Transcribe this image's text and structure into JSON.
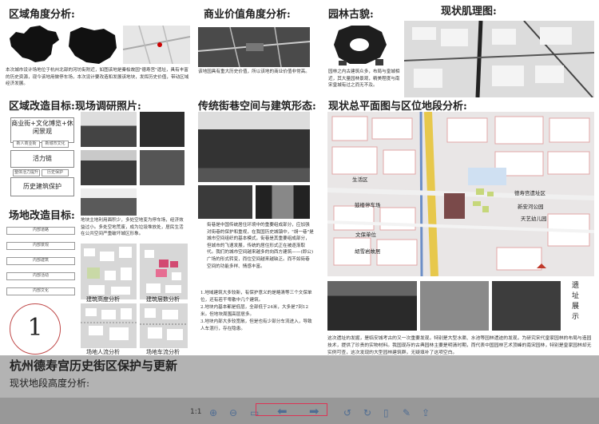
{
  "panels": {
    "region_title": "区域角度分析:",
    "region_text": "本次城市设计场地位于杭州北部的河坊街附近，如图该地是秦桧故园\"德寿宫\"遗址，具有丰富的历史资源，现今该地用做停车场，本次设计要改造和发展该地块，发挥历史价值，带动区域经济发展。",
    "commercial_title": "商业价值角度分析:",
    "commercial_text": "该地园具有重大历史价值，所以该地的商业价值非常高。",
    "garden_title": "园林古貌:",
    "garden_text": "园林之内古建筑众多，布局与皇城相近，其大量园林景观，精美程度与南宋皇城有过之而无不及。",
    "texture_title": "现状肌理图:",
    "transform_title": "区域改造目标:",
    "goal_boxes": [
      "商业街+文化博览+休闲景观",
      "活力链",
      "历史建筑保护"
    ],
    "goal_small_labels": [
      "新人商业街",
      "新城市文化",
      "整体活力提升",
      "历史保护"
    ],
    "survey_title": "现场调研照片:",
    "street_title": "传统街巷空间与建筑形态:",
    "street_text": "街巷是中国传统居住环境中的重要组成部分，应加强对街巷的保护和重视，在我国历史城镇中，\"胡一巷\"是城市空间组织的基本模式，街巷是其重要组成部分，但城市的飞速发展，传统的居住形式正在被逐渐取代。我们的城市空间越来越多的向西方建筑——(即公)广场的形式转变，而住空间越来越缺乏。而不如街巷空间的功能多样、情感丰富。",
    "street_notes": [
      "1.地域建筑大多较新，有保护意义的是略清等三个文保单位，还有若干零散中几个建筑。",
      "2.地块内基本都是低层，全部低于24米，大多是7到12米。但地块周围高层居多。",
      "3.地块内部大多较宽敞，但是也有少部分车流进入，导致人车混行，存在隐患。"
    ],
    "site_goal_title": "场地改造目标:",
    "site_goal_text": "地块主地利用面积少，多处空地变为停车场，经济效益过小。多处空地荒废，成为垃圾堆放处，居民生活在公共空间严重破坏城区形象。",
    "site_goal_items": [
      "内部道路",
      "内部景观",
      "内部建筑",
      "内部活动",
      "内部文化"
    ],
    "map_captions": [
      "建筑高度分析",
      "建筑层数分析",
      "场地人流分析",
      "场地车流分析"
    ],
    "master_title": "现状总平面图与区位地段分析:",
    "master_labels": [
      "生活区",
      "鼓楼停车场",
      "文保单位",
      "胡雪岩故居",
      "德寿宫遗址区",
      "新安河公园",
      "天艺幼儿园"
    ],
    "relics_side": [
      "遗",
      "址",
      "展",
      "示"
    ],
    "relics_text": "这次遗址的发掘，是临安城考古的又一次重要发现，特别是大型水渠、水池等园林遗迹的发现，为研究宋代皇家园林的布局与造园技术，提供了珍贵的实物材料。我国现存的古典园林主要是明清时期，而代表中国园林艺术顶峰的南宋园林，特别是皇家园林却无实例可查，这次发现的大型园林建筑群，无疑填补了这项空白。",
    "project_number": "1",
    "project_title": "杭州德寿宫历史街区保护与更新",
    "height_title": "现状地段高度分析:"
  },
  "toolbar": {
    "zoom_label": "1:1",
    "icons": [
      "zoom-in-icon",
      "zoom-out-icon",
      "fit-icon",
      "prev-icon",
      "next-icon",
      "rotate-left-icon",
      "rotate-right-icon",
      "delete-icon",
      "edit-icon",
      "share-icon"
    ]
  },
  "colors": {
    "toolbar_bg": "#909090",
    "toolbar_icon": "#4f6d93",
    "road_yellow": "#e7c84c",
    "river_blue": "#6d8fc7",
    "site_brown": "#7a4a4a",
    "green": "#c6d77a"
  }
}
